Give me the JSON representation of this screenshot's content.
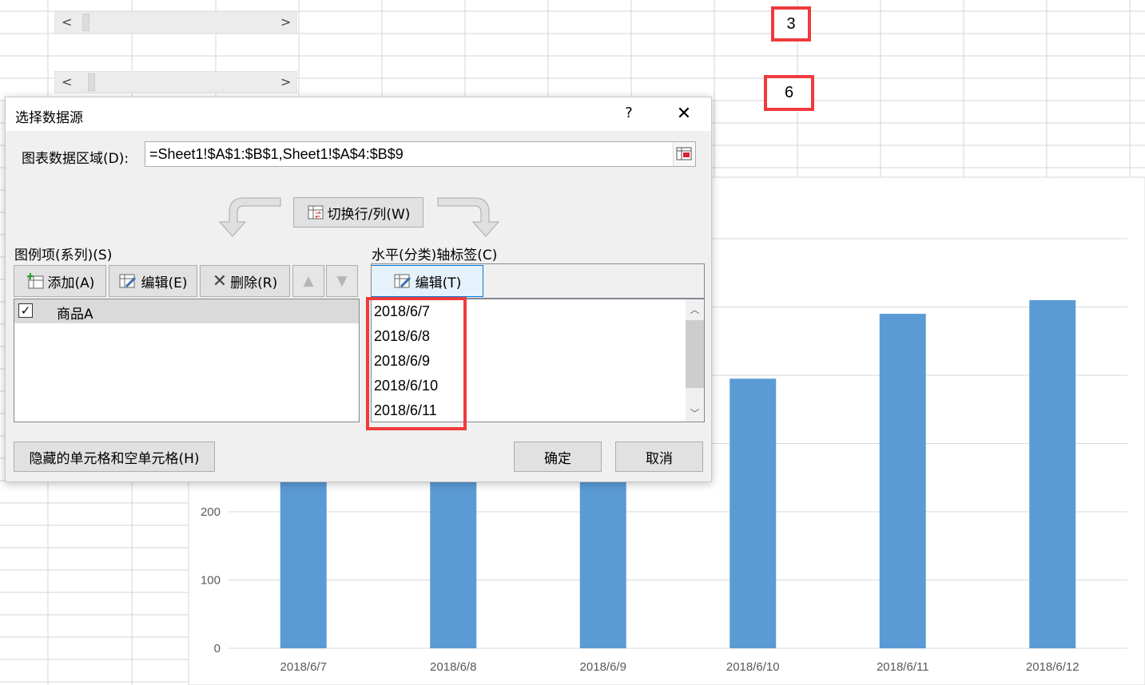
{
  "sheet": {
    "cell_values": [
      "3",
      "6"
    ],
    "scroll_left": "<",
    "scroll_right": ">"
  },
  "chart_data": {
    "type": "bar",
    "categories": [
      "2018/6/7",
      "2018/6/8",
      "2018/6/9",
      "2018/6/10",
      "2018/6/11",
      "2018/6/12"
    ],
    "series": [
      {
        "name": "商品A",
        "values": [
          420,
          440,
          420,
          395,
          490,
          510
        ]
      }
    ],
    "y_ticks": [
      "0",
      "100",
      "200"
    ],
    "ylim": [
      0,
      600
    ],
    "grid": true,
    "bar_color": "#5b9bd5"
  },
  "dialog": {
    "title": "选择数据源",
    "help": "?",
    "close": "✕",
    "range_label": "图表数据区域(D):",
    "range_value": "=Sheet1!$A$1:$B$1,Sheet1!$A$4:$B$9",
    "switch_button": "切换行/列(W)",
    "series_header": "图例项(系列)(S)",
    "add_button": "添加(A)",
    "edit_button": "编辑(E)",
    "delete_button": "删除(R)",
    "up_button": "▲",
    "down_button": "▼",
    "series_items": [
      {
        "label": "商品A",
        "checked": "✓"
      }
    ],
    "axis_header": "水平(分类)轴标签(C)",
    "axis_edit_button": "编辑(T)",
    "axis_labels": [
      "2018/6/7",
      "2018/6/8",
      "2018/6/9",
      "2018/6/10",
      "2018/6/11"
    ],
    "hidden_cells_button": "隐藏的单元格和空单元格(H)",
    "ok_button": "确定",
    "cancel_button": "取消"
  },
  "colors": {
    "highlight": "#ee3b3b",
    "bar": "#5b9bd5"
  }
}
